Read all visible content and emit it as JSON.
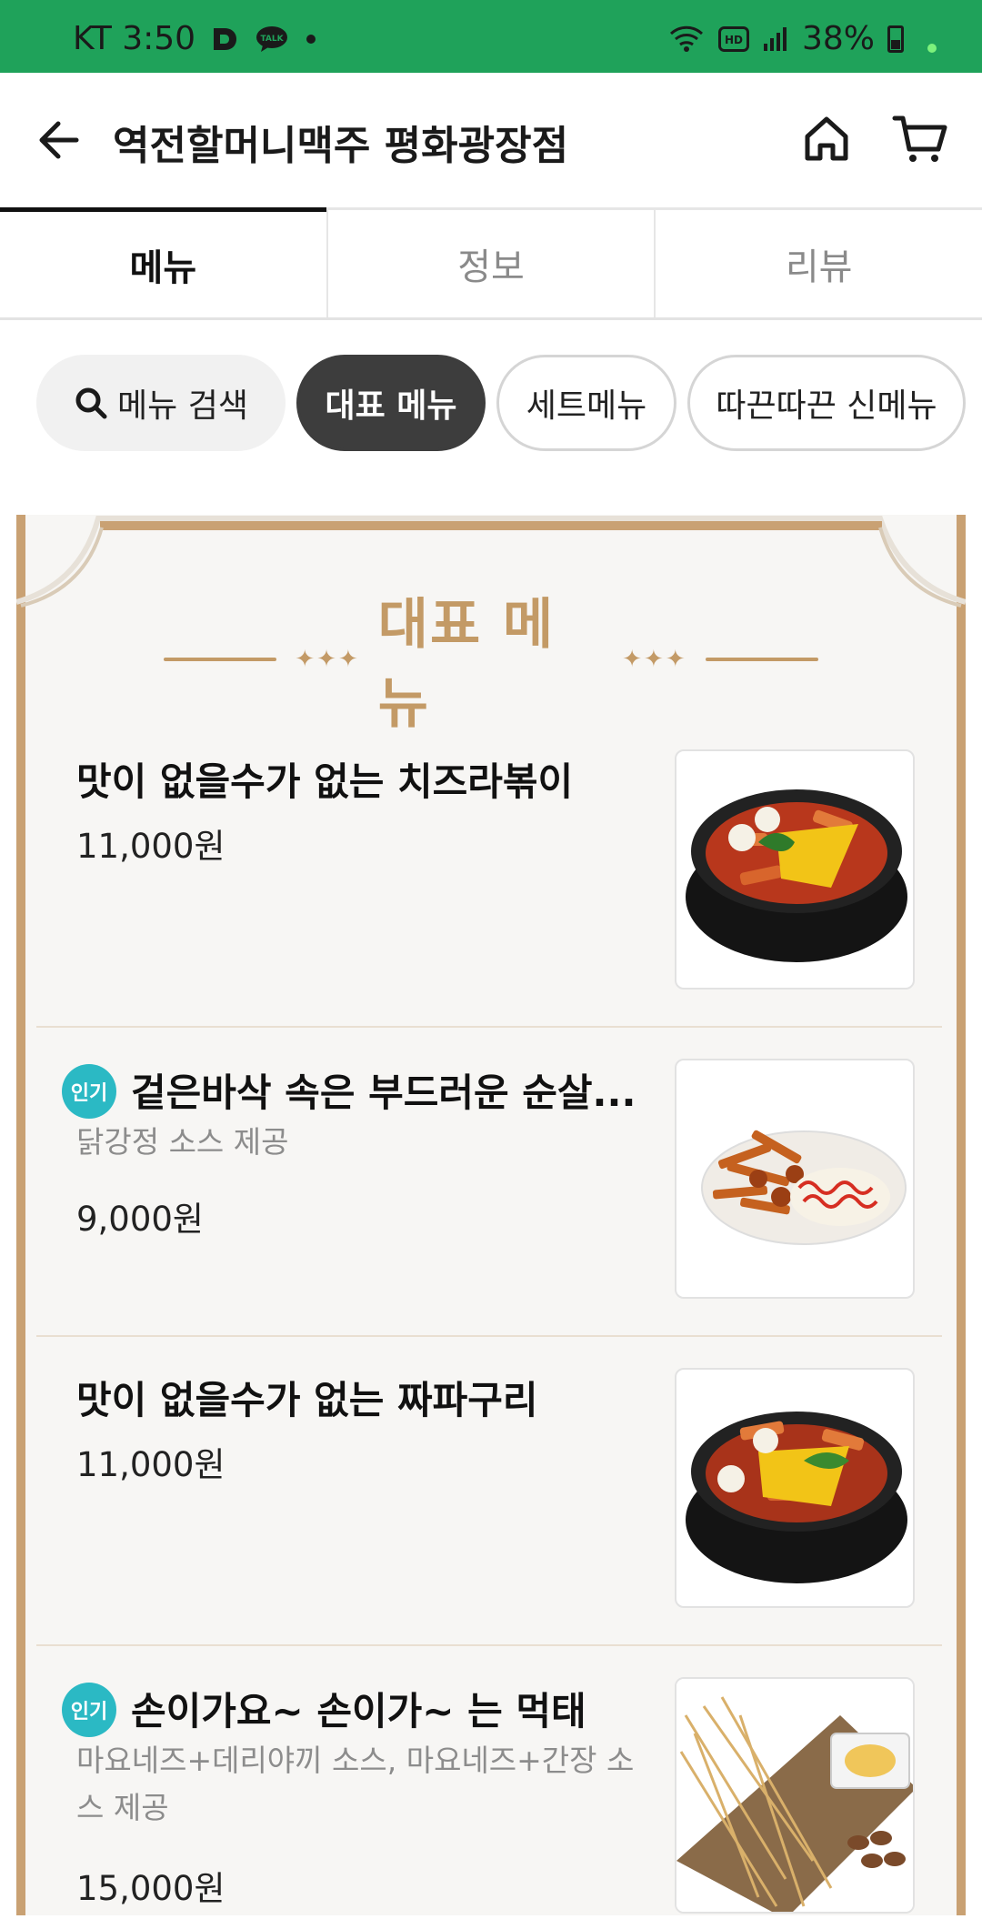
{
  "status_bar": {
    "carrier_time": "KT 3:50",
    "indicators": [
      "d-app-icon",
      "kakaotalk-icon",
      "dot-icon"
    ],
    "battery": "38%"
  },
  "header": {
    "store_name": "역전할머니맥주 평화광장점",
    "icons": [
      "back-arrow-icon",
      "home-icon",
      "cart-icon"
    ]
  },
  "tabs": [
    {
      "label": "메뉴",
      "active": true
    },
    {
      "label": "정보",
      "active": false
    },
    {
      "label": "리뷰",
      "active": false
    }
  ],
  "chips": {
    "search_label": "메뉴 검색",
    "items": [
      "대표 메뉴",
      "세트메뉴",
      "따끈따끈 신메뉴"
    ],
    "selected": "대표 메뉴"
  },
  "section": {
    "title": "대표 메뉴"
  },
  "menu_items": [
    {
      "name": "맛이 없을수가 없는 치즈라볶이",
      "badge": "",
      "description": "",
      "price": "11,000원"
    },
    {
      "name": "겉은바삭 속은 부드러운 순살...",
      "badge": "인기",
      "description": "닭강정 소스 제공",
      "price": "9,000원"
    },
    {
      "name": "맛이 없을수가 없는 짜파구리",
      "badge": "",
      "description": "",
      "price": "11,000원"
    },
    {
      "name": "손이가요~ 손이가~ 는 먹태",
      "badge": "인기",
      "description": "마요네즈+데리야끼 소스, 마요네즈+간장 소스 제공",
      "price": "15,000원"
    }
  ],
  "colors": {
    "status_bar": "#1fa25a",
    "board_frame": "#c9a173",
    "section_title": "#c39a66",
    "badge": "#2bb9c4",
    "chip_selected": "#3d3d3d"
  }
}
